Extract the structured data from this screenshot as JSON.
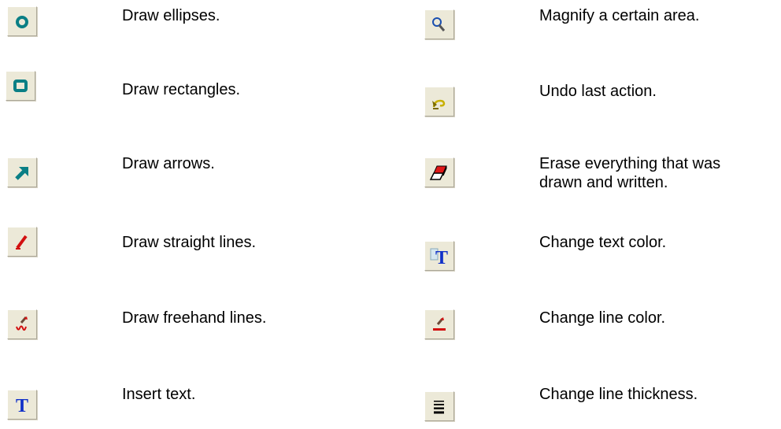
{
  "tools": {
    "left": [
      {
        "icon": "ellipse-icon",
        "description": "Draw ellipses."
      },
      {
        "icon": "rectangle-icon",
        "description": "Draw rectangles."
      },
      {
        "icon": "arrow-icon",
        "description": "Draw arrows."
      },
      {
        "icon": "straight-line-icon",
        "description": "Draw straight lines."
      },
      {
        "icon": "freehand-line-icon",
        "description": "Draw freehand lines."
      },
      {
        "icon": "text-icon",
        "description": "Insert text."
      }
    ],
    "right": [
      {
        "icon": "magnify-icon",
        "description": "Magnify a certain area."
      },
      {
        "icon": "undo-icon",
        "description": "Undo last action."
      },
      {
        "icon": "eraser-icon",
        "description": "Erase everything that was\ndrawn and written."
      },
      {
        "icon": "text-color-icon",
        "description": "Change text color."
      },
      {
        "icon": "line-color-icon",
        "description": "Change line color."
      },
      {
        "icon": "line-thickness-icon",
        "description": "Change line thickness."
      }
    ]
  }
}
